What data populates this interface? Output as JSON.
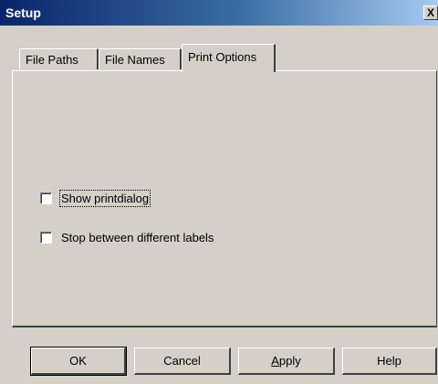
{
  "window": {
    "title": "Setup",
    "close_glyph": "X"
  },
  "tabs": [
    {
      "label": "File Paths",
      "active": false
    },
    {
      "label": "File Names",
      "active": false
    },
    {
      "label": "Print Options",
      "active": true
    }
  ],
  "options": {
    "show_printdialog": {
      "label": "Show printdialog",
      "checked": false
    },
    "stop_between_labels": {
      "label": "Stop between different labels",
      "checked": false
    }
  },
  "buttons": {
    "ok": "OK",
    "cancel": "Cancel",
    "apply": "Apply",
    "help": "Help"
  }
}
